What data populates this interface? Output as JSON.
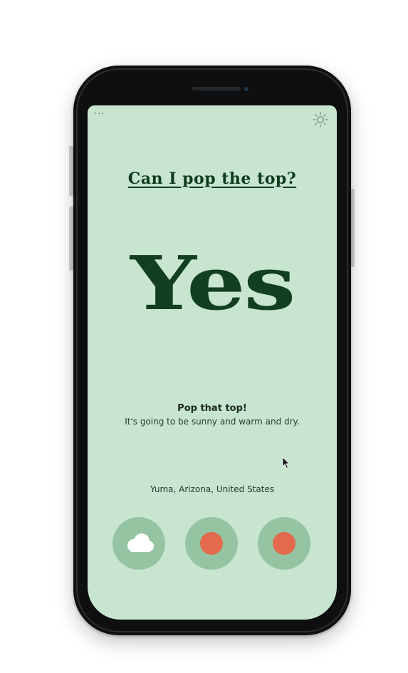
{
  "app": {
    "headline": "Can I pop the top?",
    "answer": "Yes",
    "status_title": "Pop that top!",
    "status_description": "It's going to be sunny and warm and dry.",
    "location": "Yuma, Arizona, United States",
    "menu_dots": "···"
  },
  "forecast": [
    {
      "icon": "cloud-icon"
    },
    {
      "icon": "sun-dot-icon"
    },
    {
      "icon": "sun-dot-icon"
    }
  ],
  "colors": {
    "screen_background": "#c8e5d0",
    "headline": "#0d3b1e",
    "answer": "#123f1f",
    "forecast_circle": "#95c4a3",
    "sun_dot": "#e36a4c",
    "cloud": "#ffffff"
  }
}
